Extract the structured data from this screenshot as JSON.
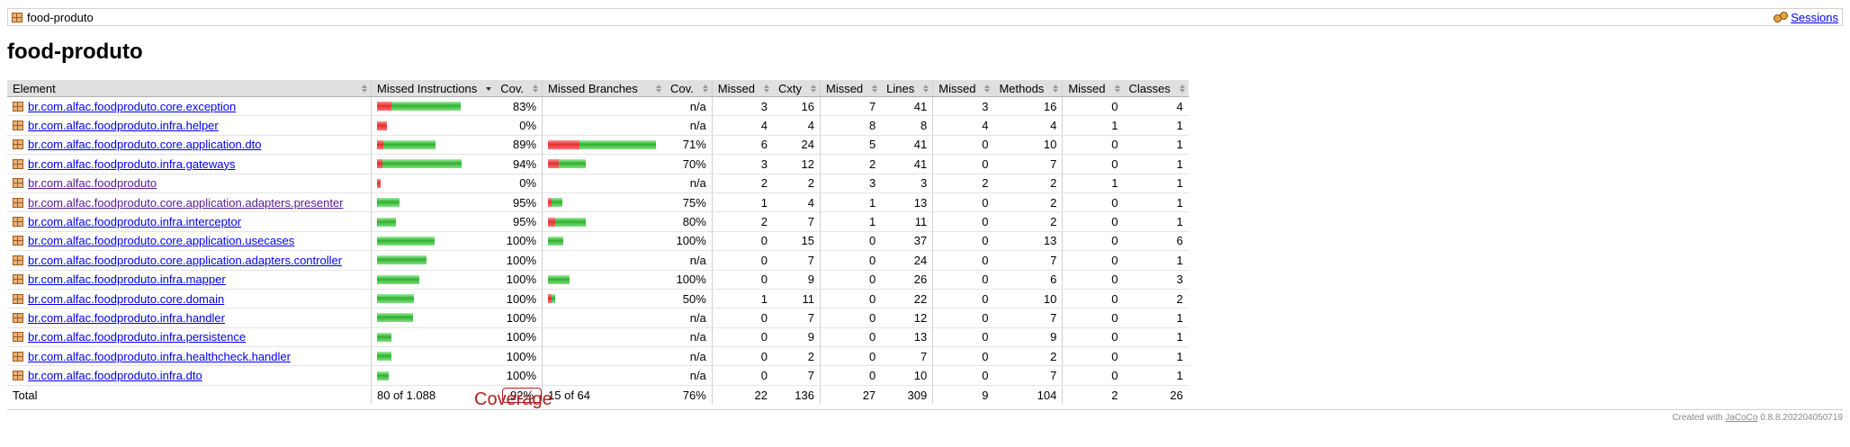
{
  "breadcrumb": {
    "label": "food-produto",
    "sessions_label": "Sessions"
  },
  "page_title": "food-produto",
  "table": {
    "headers": {
      "element": "Element",
      "missed_instructions": "Missed Instructions",
      "inst_cov": "Cov.",
      "missed_branches": "Missed Branches",
      "branch_cov": "Cov.",
      "missed_cxty": "Missed",
      "cxty": "Cxty",
      "missed_lines": "Missed",
      "lines": "Lines",
      "missed_methods": "Missed",
      "methods": "Methods",
      "missed_classes": "Missed",
      "classes": "Classes"
    },
    "rows": [
      {
        "name": "br.com.alfac.foodproduto.core.exception",
        "visited": false,
        "ins_red": 0.13,
        "ins_green": 0.64,
        "ins_cov": "83%",
        "br_red": 0,
        "br_green": 0,
        "br_cov": "n/a",
        "mcx": "3",
        "cx": "16",
        "ml": "7",
        "l": "41",
        "mm": "3",
        "m": "16",
        "mc": "0",
        "c": "4"
      },
      {
        "name": "br.com.alfac.foodproduto.infra.helper",
        "visited": false,
        "ins_red": 0.09,
        "ins_green": 0,
        "ins_cov": "0%",
        "br_red": 0,
        "br_green": 0,
        "br_cov": "n/a",
        "mcx": "4",
        "cx": "4",
        "ml": "8",
        "l": "8",
        "mm": "4",
        "m": "4",
        "mc": "1",
        "c": "1"
      },
      {
        "name": "br.com.alfac.foodproduto.core.application.dto",
        "visited": false,
        "ins_red": 0.06,
        "ins_green": 0.48,
        "ins_cov": "89%",
        "br_red": 0.29,
        "br_green": 0.71,
        "br_cov": "71%",
        "mcx": "6",
        "cx": "24",
        "ml": "5",
        "l": "41",
        "mm": "0",
        "m": "10",
        "mc": "0",
        "c": "1"
      },
      {
        "name": "br.com.alfac.foodproduto.infra.gateways",
        "visited": false,
        "ins_red": 0.05,
        "ins_green": 0.73,
        "ins_cov": "94%",
        "br_red": 0.1,
        "br_green": 0.25,
        "br_cov": "70%",
        "mcx": "3",
        "cx": "12",
        "ml": "2",
        "l": "41",
        "mm": "0",
        "m": "7",
        "mc": "0",
        "c": "1"
      },
      {
        "name": "br.com.alfac.foodproduto",
        "visited": true,
        "ins_red": 0.035,
        "ins_green": 0,
        "ins_cov": "0%",
        "br_red": 0,
        "br_green": 0,
        "br_cov": "n/a",
        "mcx": "2",
        "cx": "2",
        "ml": "3",
        "l": "3",
        "mm": "2",
        "m": "2",
        "mc": "1",
        "c": "1"
      },
      {
        "name": "br.com.alfac.foodproduto.core.application.adapters.presenter",
        "visited": true,
        "ins_red": 0.01,
        "ins_green": 0.2,
        "ins_cov": "95%",
        "br_red": 0.03,
        "br_green": 0.1,
        "br_cov": "75%",
        "mcx": "1",
        "cx": "4",
        "ml": "1",
        "l": "13",
        "mm": "0",
        "m": "2",
        "mc": "0",
        "c": "1"
      },
      {
        "name": "br.com.alfac.foodproduto.infra.interceptor",
        "visited": false,
        "ins_red": 0.01,
        "ins_green": 0.17,
        "ins_cov": "95%",
        "br_red": 0.07,
        "br_green": 0.28,
        "br_cov": "80%",
        "mcx": "2",
        "cx": "7",
        "ml": "1",
        "l": "11",
        "mm": "0",
        "m": "2",
        "mc": "0",
        "c": "1"
      },
      {
        "name": "br.com.alfac.foodproduto.core.application.usecases",
        "visited": false,
        "ins_red": 0,
        "ins_green": 0.53,
        "ins_cov": "100%",
        "br_red": 0,
        "br_green": 0.14,
        "br_cov": "100%",
        "mcx": "0",
        "cx": "15",
        "ml": "0",
        "l": "37",
        "mm": "0",
        "m": "13",
        "mc": "0",
        "c": "6"
      },
      {
        "name": "br.com.alfac.foodproduto.core.application.adapters.controller",
        "visited": false,
        "ins_red": 0,
        "ins_green": 0.46,
        "ins_cov": "100%",
        "br_red": 0,
        "br_green": 0,
        "br_cov": "n/a",
        "mcx": "0",
        "cx": "7",
        "ml": "0",
        "l": "24",
        "mm": "0",
        "m": "7",
        "mc": "0",
        "c": "1"
      },
      {
        "name": "br.com.alfac.foodproduto.infra.mapper",
        "visited": false,
        "ins_red": 0,
        "ins_green": 0.39,
        "ins_cov": "100%",
        "br_red": 0,
        "br_green": 0.2,
        "br_cov": "100%",
        "mcx": "0",
        "cx": "9",
        "ml": "0",
        "l": "26",
        "mm": "0",
        "m": "6",
        "mc": "0",
        "c": "3"
      },
      {
        "name": "br.com.alfac.foodproduto.core.domain",
        "visited": false,
        "ins_red": 0,
        "ins_green": 0.34,
        "ins_cov": "100%",
        "br_red": 0.03,
        "br_green": 0.03,
        "br_cov": "50%",
        "mcx": "1",
        "cx": "11",
        "ml": "0",
        "l": "22",
        "mm": "0",
        "m": "10",
        "mc": "0",
        "c": "2"
      },
      {
        "name": "br.com.alfac.foodproduto.infra.handler",
        "visited": false,
        "ins_red": 0,
        "ins_green": 0.33,
        "ins_cov": "100%",
        "br_red": 0,
        "br_green": 0,
        "br_cov": "n/a",
        "mcx": "0",
        "cx": "7",
        "ml": "0",
        "l": "12",
        "mm": "0",
        "m": "7",
        "mc": "0",
        "c": "1"
      },
      {
        "name": "br.com.alfac.foodproduto.infra.persistence",
        "visited": false,
        "ins_red": 0,
        "ins_green": 0.13,
        "ins_cov": "100%",
        "br_red": 0,
        "br_green": 0,
        "br_cov": "n/a",
        "mcx": "0",
        "cx": "9",
        "ml": "0",
        "l": "13",
        "mm": "0",
        "m": "9",
        "mc": "0",
        "c": "1"
      },
      {
        "name": "br.com.alfac.foodproduto.infra.healthcheck.handler",
        "visited": false,
        "ins_red": 0,
        "ins_green": 0.13,
        "ins_cov": "100%",
        "br_red": 0,
        "br_green": 0,
        "br_cov": "n/a",
        "mcx": "0",
        "cx": "2",
        "ml": "0",
        "l": "7",
        "mm": "0",
        "m": "2",
        "mc": "0",
        "c": "1"
      },
      {
        "name": "br.com.alfac.foodproduto.infra.dto",
        "visited": false,
        "ins_red": 0,
        "ins_green": 0.11,
        "ins_cov": "100%",
        "br_red": 0,
        "br_green": 0,
        "br_cov": "n/a",
        "mcx": "0",
        "cx": "7",
        "ml": "0",
        "l": "10",
        "mm": "0",
        "m": "7",
        "mc": "0",
        "c": "1"
      }
    ],
    "total": {
      "label": "Total",
      "missed_instructions": "80 of 1.088",
      "ins_cov": "92%",
      "missed_branches": "15 of 64",
      "br_cov": "76%",
      "mcx": "22",
      "cx": "136",
      "ml": "27",
      "l": "309",
      "mm": "9",
      "m": "104",
      "mc": "2",
      "c": "26"
    }
  },
  "annotation": "Coverage",
  "footer": {
    "prefix": "Created with",
    "link": "JaCoCo",
    "version": "0.8.8.202204050719"
  },
  "colors": {
    "missed": "#e03030",
    "covered": "#30b030",
    "annotation": "#b02020"
  }
}
